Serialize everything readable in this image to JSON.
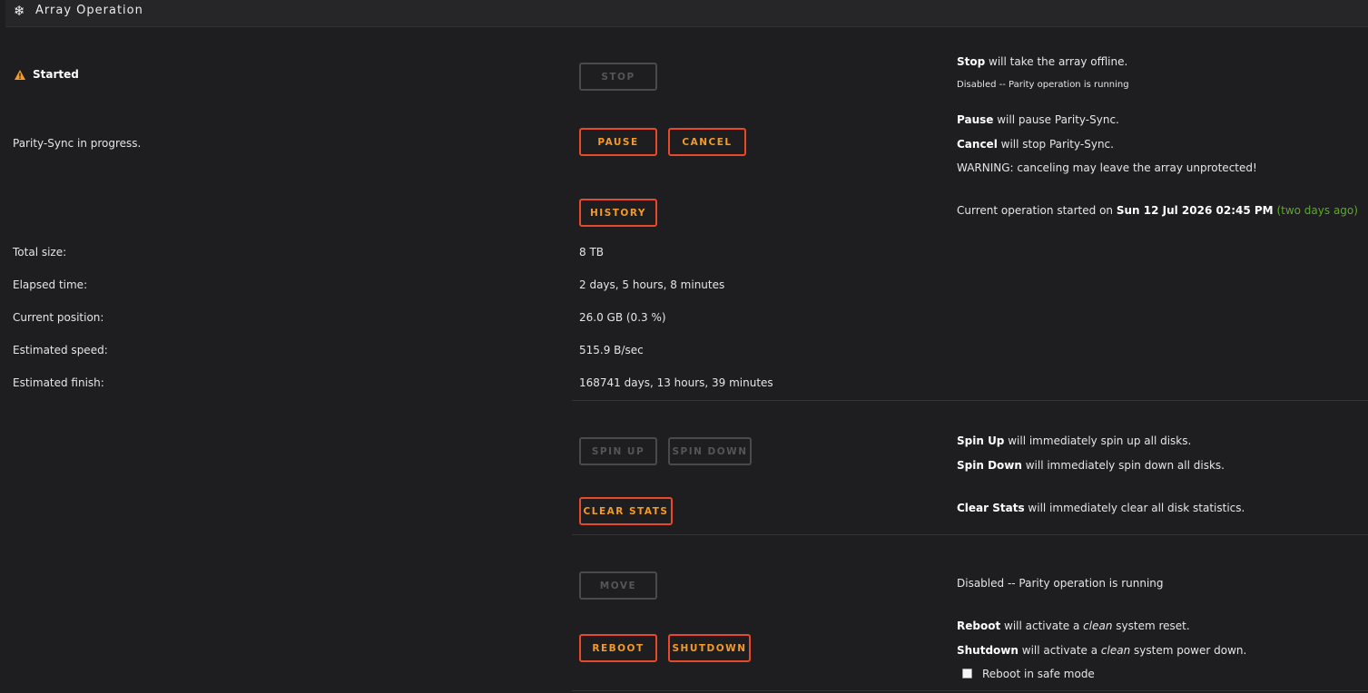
{
  "header": {
    "icon": "snowflake-icon",
    "title": "Array Operation"
  },
  "status": {
    "icon": "warning-icon",
    "label": "Started"
  },
  "parity_label": "Parity-Sync in progress.",
  "buttons": {
    "stop": "STOP",
    "pause": "PAUSE",
    "cancel": "CANCEL",
    "history": "HISTORY",
    "spin_up": "SPIN UP",
    "spin_down": "SPIN DOWN",
    "clear_stats": "CLEAR STATS",
    "move": "MOVE",
    "reboot": "REBOOT",
    "shutdown": "SHUTDOWN"
  },
  "help": {
    "stop_bold": "Stop",
    "stop_text": " will take the array offline.",
    "stop_disabled": "Disabled -- Parity operation is running",
    "pause_bold": "Pause",
    "pause_text": " will pause Parity-Sync.",
    "cancel_bold": "Cancel",
    "cancel_text": " will stop Parity-Sync.",
    "warning": "WARNING: canceling may leave the array unprotected!",
    "started_prefix": "Current operation started on ",
    "started_date": "Sun 12 Jul 2026 02:45 PM",
    "started_ago": "(two days ago)",
    "spin_up_bold": "Spin Up",
    "spin_up_text": " will immediately spin up all disks.",
    "spin_down_bold": "Spin Down",
    "spin_down_text": " will immediately spin down all disks.",
    "clear_bold": "Clear Stats",
    "clear_text": " will immediately clear all disk statistics.",
    "move_disabled": "Disabled -- Parity operation is running",
    "reboot_bold": "Reboot",
    "reboot_pre": " will activate a ",
    "reboot_em": "clean",
    "reboot_post": " system reset.",
    "shutdown_bold": "Shutdown",
    "shutdown_pre": " will activate a ",
    "shutdown_em": "clean",
    "shutdown_post": " system power down.",
    "safe_mode_label": "Reboot in safe mode"
  },
  "stats": [
    {
      "label": "Total size:",
      "value": "8 TB"
    },
    {
      "label": "Elapsed time:",
      "value": "2 days, 5 hours, 8 minutes"
    },
    {
      "label": "Current position:",
      "value": "26.0 GB (0.3 %)"
    },
    {
      "label": "Estimated speed:",
      "value": "515.9 B/sec"
    },
    {
      "label": "Estimated finish:",
      "value": "168741 days, 13 hours, 39 minutes"
    }
  ],
  "safe_mode_checked": false,
  "colors": {
    "accent_border": "#e8492a",
    "accent_text": "#f39a28",
    "warning": "#f39a28",
    "green": "#5bab2a"
  }
}
